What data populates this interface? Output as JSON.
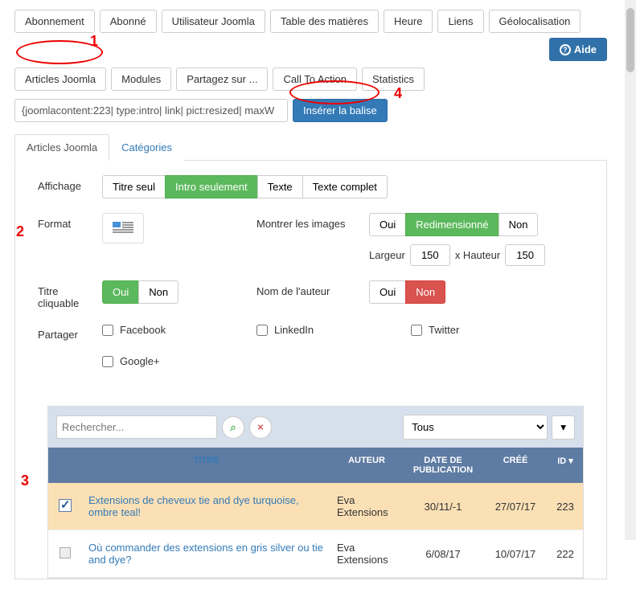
{
  "annotations": {
    "a1": "1",
    "a2": "2",
    "a3": "3",
    "a4": "4"
  },
  "help_button": "Aide",
  "top_buttons_row1": [
    "Abonnement",
    "Abonné",
    "Utilisateur Joomla",
    "Table des matières",
    "Heure",
    "Liens",
    "Géolocalisation"
  ],
  "top_buttons_row2": [
    "Articles Joomla",
    "Modules",
    "Partagez sur ...",
    "Call To Action",
    "Statistics"
  ],
  "tag_input_value": "{joomlacontent:223| type:intro| link| pict:resized| maxW",
  "insert_button": "Insérer la balise",
  "tabs": {
    "active": "Articles Joomla",
    "inactive": "Catégories"
  },
  "affichage": {
    "label": "Affichage",
    "options": [
      "Titre seul",
      "Intro seulement",
      "Texte",
      "Texte complet"
    ],
    "active_index": 1
  },
  "format": {
    "label": "Format"
  },
  "images": {
    "label": "Montrer les images",
    "options": [
      "Oui",
      "Redimensionné",
      "Non"
    ],
    "active_index": 1,
    "largeur_label": "Largeur",
    "largeur_value": "150",
    "hauteur_label": "x Hauteur",
    "hauteur_value": "150"
  },
  "titre_cliquable": {
    "label": "Titre cliquable",
    "options": [
      "Oui",
      "Non"
    ],
    "active_index": 0
  },
  "nom_auteur": {
    "label": "Nom de l'auteur",
    "options": [
      "Oui",
      "Non"
    ],
    "active_index": 1
  },
  "partager": {
    "label": "Partager",
    "options": [
      "Facebook",
      "LinkedIn",
      "Twitter",
      "Google+"
    ]
  },
  "search": {
    "placeholder": "Rechercher...",
    "status": "Tous"
  },
  "table": {
    "headers": {
      "titre": "TITRE",
      "auteur": "AUTEUR",
      "pub": "DATE DE PUBLICATION",
      "created": "CRÉÉ",
      "id": "ID"
    },
    "rows": [
      {
        "checked": true,
        "titre": "Extensions de cheveux tie and dye turquoise, ombre teal!",
        "auteur": "Eva Extensions",
        "pub": "30/11/-1",
        "created": "27/07/17",
        "id": "223"
      },
      {
        "checked": false,
        "titre": "Où commander des extensions en gris silver ou tie and dye?",
        "auteur": "Eva Extensions",
        "pub": "6/08/17",
        "created": "10/07/17",
        "id": "222"
      }
    ]
  }
}
